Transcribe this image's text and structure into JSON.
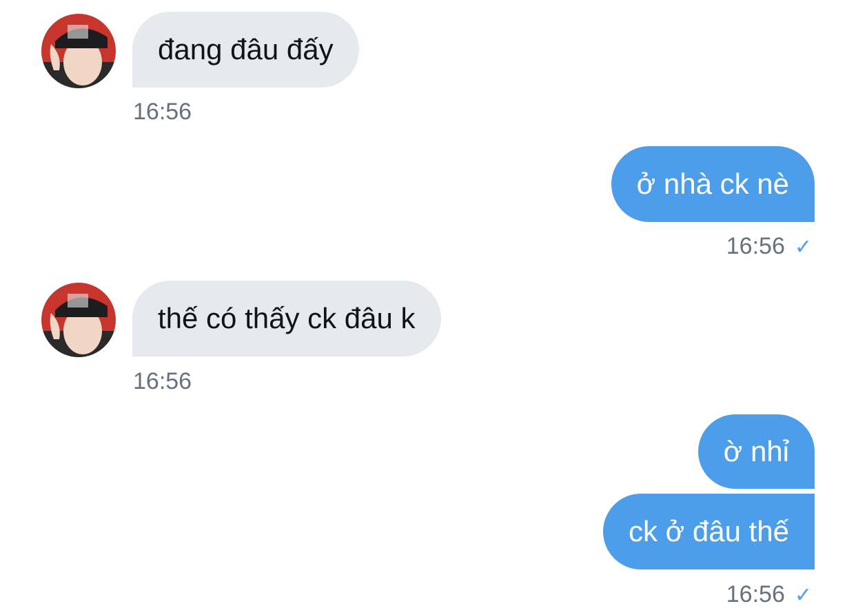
{
  "conversation": {
    "messages": [
      {
        "id": "m1",
        "direction": "incoming",
        "text": "đang đâu đấy",
        "time": "16:56"
      },
      {
        "id": "m2",
        "direction": "outgoing",
        "text": "ở nhà ck nè",
        "time": "16:56",
        "status": "sent"
      },
      {
        "id": "m3",
        "direction": "incoming",
        "text": "thế có thấy ck đâu k",
        "time": "16:56"
      },
      {
        "id": "m4",
        "direction": "outgoing",
        "text": "ờ nhỉ"
      },
      {
        "id": "m5",
        "direction": "outgoing",
        "text": "ck ở đâu thế",
        "time": "16:56",
        "status": "sent"
      }
    ],
    "icons": {
      "avatar": "avatar-photo",
      "read_status": "checkmark-icon"
    },
    "colors": {
      "incoming_bubble": "#e6e9ee",
      "outgoing_bubble": "#4c9eea",
      "timestamp": "#66717d",
      "checkmark": "#4c9eea"
    }
  }
}
